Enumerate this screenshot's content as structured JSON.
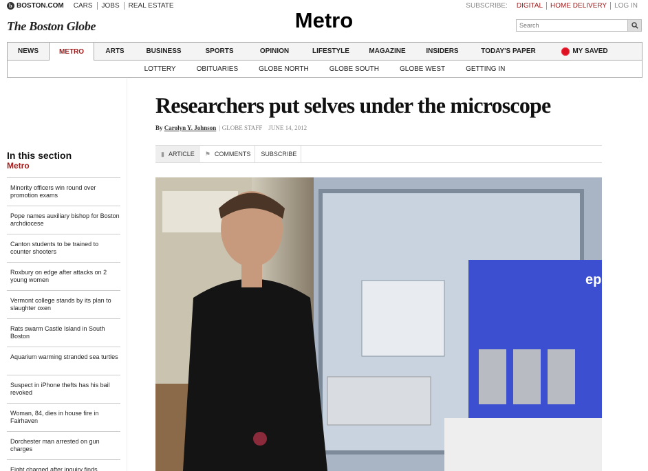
{
  "top_bar": {
    "site": "BOSTON.COM",
    "links": [
      "CARS",
      "JOBS",
      "REAL ESTATE"
    ]
  },
  "top_right": {
    "subscribe_label": "SUBSCRIBE:",
    "links": [
      "DIGITAL",
      "HOME DELIVERY",
      "LOG IN"
    ]
  },
  "masthead": {
    "logo": "The Boston Globe",
    "section": "Metro"
  },
  "search": {
    "placeholder": "Search"
  },
  "nav": {
    "primary": [
      "NEWS",
      "METRO",
      "ARTS",
      "BUSINESS",
      "SPORTS",
      "OPINION",
      "LIFESTYLE",
      "MAGAZINE",
      "INSIDERS",
      "TODAY'S PAPER",
      "MY SAVED"
    ],
    "active": "METRO",
    "secondary": [
      "LOTTERY",
      "OBITUARIES",
      "GLOBE NORTH",
      "GLOBE SOUTH",
      "GLOBE WEST",
      "GETTING IN"
    ]
  },
  "sidebar": {
    "heading": "In this section",
    "section": "Metro",
    "items": [
      "Minority officers win round over promotion exams",
      "Pope names auxiliary bishop for Boston archdiocese",
      "Canton students to be trained to counter shooters",
      "Roxbury on edge after attacks on 2 young women",
      "Vermont college stands by its plan to slaughter oxen",
      "Rats swarm Castle Island in South Boston",
      "Aquarium warming stranded sea turtles",
      "Suspect in iPhone thefts has his bail revoked",
      "Woman, 84, dies in house fire in Fairhaven",
      "Dorchester man arrested on gun charges",
      "Eight charged after inquiry finds"
    ]
  },
  "article": {
    "headline": "Researchers put selves under the microscope",
    "by": "By",
    "author": "Carolyn Y. Johnson",
    "staff": "GLOBE STAFF",
    "date": "JUNE 14, 2012",
    "tabs": [
      "ARTICLE",
      "COMMENTS",
      "SUBSCRIBE"
    ]
  },
  "colors": {
    "accent": "#a01b1b"
  }
}
